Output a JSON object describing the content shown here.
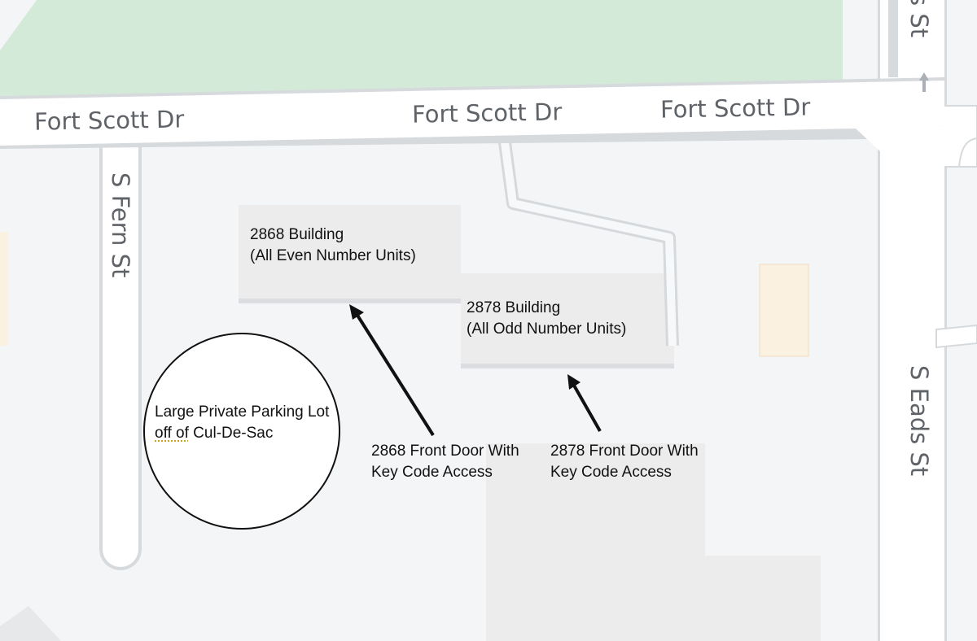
{
  "streets": {
    "fort_scott_1": "Fort Scott Dr",
    "fort_scott_2": "Fort Scott Dr",
    "fort_scott_3": "Fort Scott Dr",
    "fern": "S Fern St",
    "eads": "S Eads St",
    "eads_top": "s St"
  },
  "buildings": {
    "b2868": {
      "line1": "2868 Building",
      "line2": "(All Even Number Units)"
    },
    "b2878": {
      "line1": "2878 Building",
      "line2": "(All Odd Number Units)"
    }
  },
  "doors": {
    "d2868": {
      "line1": "2868 Front Door With",
      "line2": "Key Code Access"
    },
    "d2878": {
      "line1": "2878 Front Door With",
      "line2": "Key Code Access"
    }
  },
  "parking": {
    "line1": "Large Private Parking Lot",
    "line2_a": "off of",
    "line2_b": " Cul-De-Sac"
  },
  "colors": {
    "background": "#f4f5f7",
    "park": "#d3ead9",
    "road": "#ffffff",
    "road_edge": "#d7dadd",
    "building": "#ececed",
    "annotation": "#111111"
  },
  "icons": {
    "oneway": "up-arrow-icon"
  }
}
